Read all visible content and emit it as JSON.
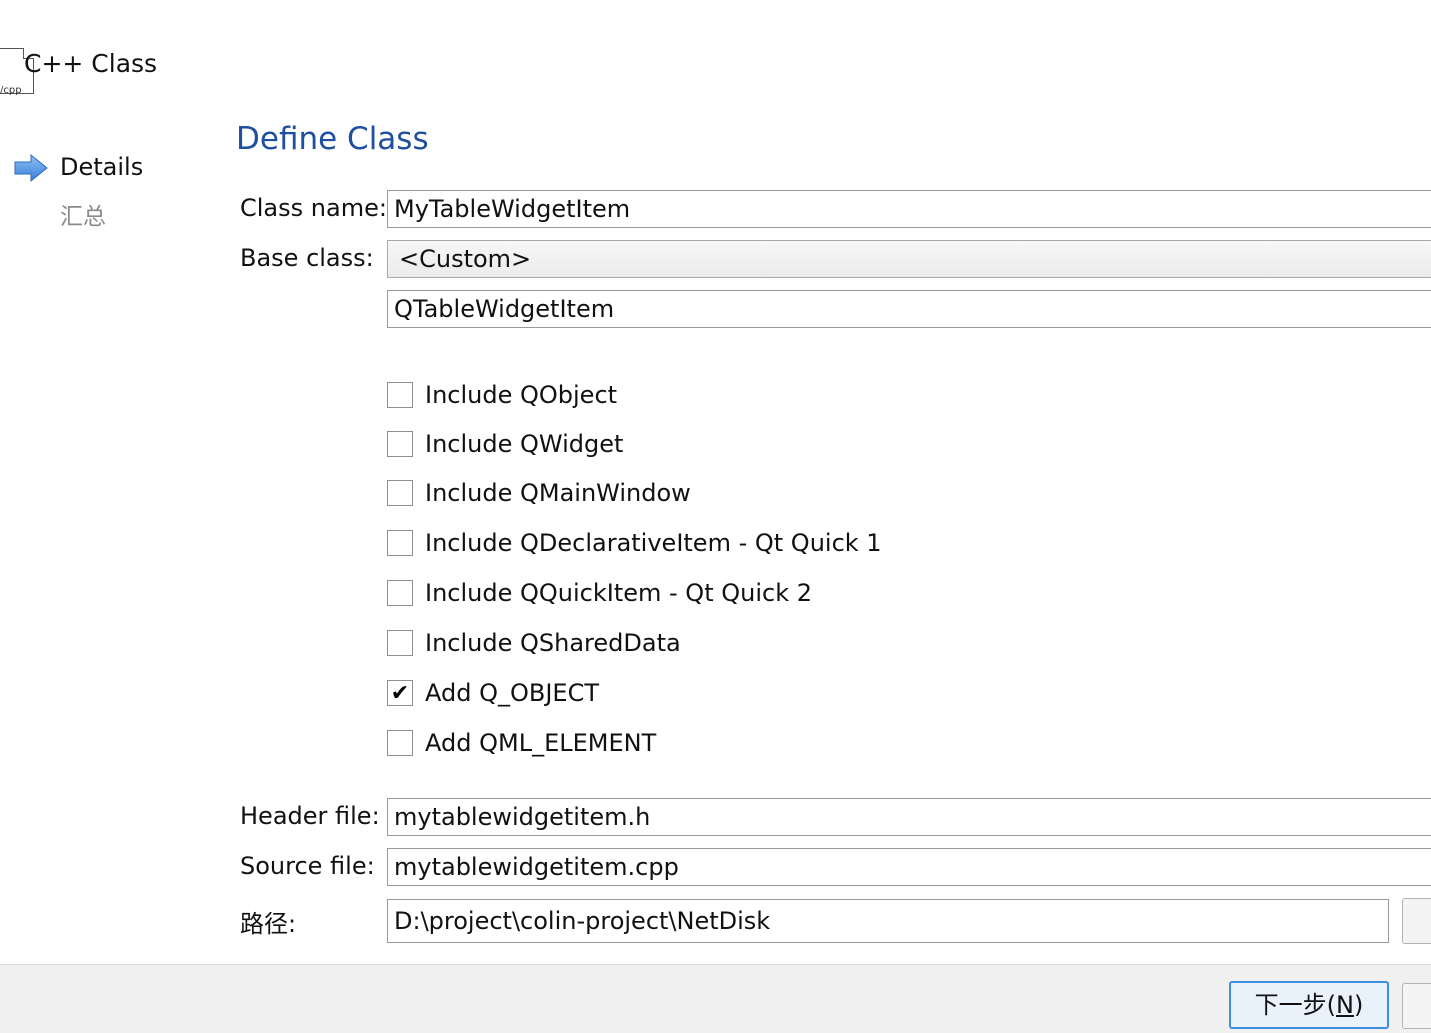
{
  "wizard": {
    "title": "C++ Class",
    "icon_ext": "/cpp",
    "steps": [
      {
        "label": "Details",
        "current": true
      },
      {
        "label": "汇总",
        "current": false
      }
    ]
  },
  "page": {
    "heading": "Define Class"
  },
  "form": {
    "class_name_label": "Class name:",
    "class_name_value": "MyTableWidgetItem",
    "base_class_label": "Base class:",
    "base_class_selected": "<Custom>",
    "custom_base_value": "QTableWidgetItem",
    "options": [
      {
        "label": "Include QObject",
        "checked": false
      },
      {
        "label": "Include QWidget",
        "checked": false
      },
      {
        "label": "Include QMainWindow",
        "checked": false
      },
      {
        "label": "Include QDeclarativeItem - Qt Quick 1",
        "checked": false
      },
      {
        "label": "Include QQuickItem - Qt Quick 2",
        "checked": false
      },
      {
        "label": "Include QSharedData",
        "checked": false
      },
      {
        "label": "Add Q_OBJECT",
        "checked": true
      },
      {
        "label": "Add QML_ELEMENT",
        "checked": false
      }
    ],
    "header_file_label": "Header file:",
    "header_file_value": "mytablewidgetitem.h",
    "source_file_label": "Source file:",
    "source_file_value": "mytablewidgetitem.cpp",
    "path_label": "路径:",
    "path_value": "D:\\project\\colin-project\\NetDisk"
  },
  "footer": {
    "next_label": "下一步(",
    "next_mnemonic": "N",
    "next_suffix": ")"
  },
  "colors": {
    "heading": "#1f4fa0",
    "step_arrow": "#4a90e2",
    "footer_bg": "#f0f0f0"
  },
  "icons": [
    "file-cpp-icon",
    "step-arrow-icon",
    "checkmark-icon"
  ]
}
